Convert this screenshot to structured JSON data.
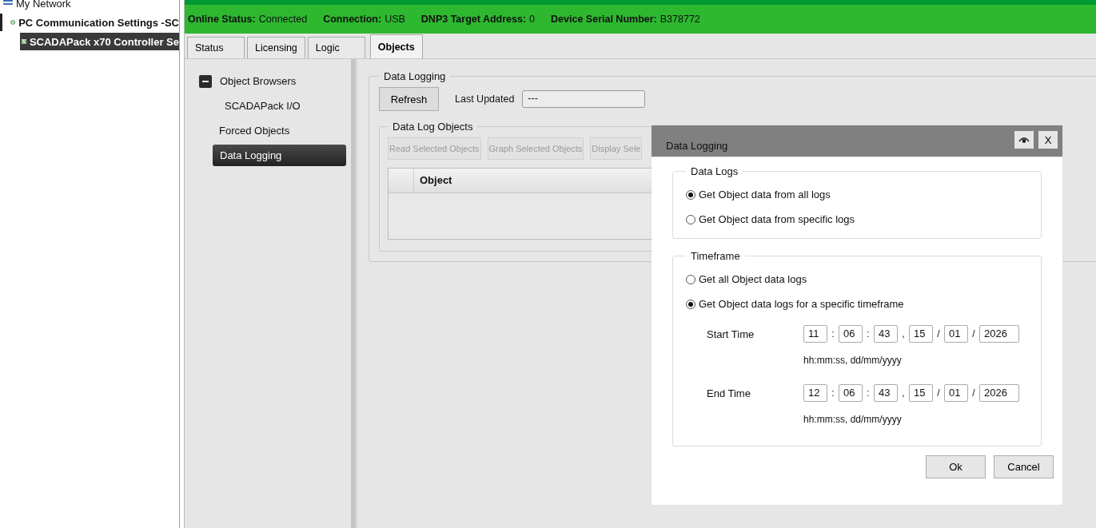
{
  "tree": [
    {
      "label": "My Network",
      "selected": false,
      "children": [
        {
          "label": "PC Communication Settings -SC",
          "selected": false,
          "children": [
            {
              "label": "SCADAPack x70 Controller Se",
              "selected": true
            }
          ]
        }
      ]
    }
  ],
  "status_bar": [
    {
      "label": "Online Status:",
      "value": "Connected"
    },
    {
      "label": "Connection:",
      "value": "USB"
    },
    {
      "label": "DNP3 Target Address:",
      "value": "0"
    },
    {
      "label": "Device Serial Number:",
      "value": "B378772"
    }
  ],
  "tabs": [
    {
      "label": "Status",
      "selected": false
    },
    {
      "label": "Licensing",
      "selected": false
    },
    {
      "label": "Logic",
      "selected": false
    },
    {
      "label": "Objects",
      "selected": true
    }
  ],
  "nav": [
    {
      "label": "Object Browsers",
      "selected": false,
      "expanded": true,
      "children": [
        {
          "label": "SCADAPack I/O",
          "selected": false
        }
      ]
    },
    {
      "label": "Forced Objects",
      "selected": false
    },
    {
      "label": "Data Logging",
      "selected": true
    }
  ],
  "data_logging": {
    "title": "Data Logging",
    "refresh_button": "Refresh",
    "last_updated_label": "Last Updated",
    "last_updated_value": "---",
    "objects_group": {
      "title": "Data Log Objects",
      "buttons": [
        {
          "label": "Read Selected Objects",
          "disabled": true
        },
        {
          "label": "Graph Selected Objects",
          "disabled": true
        },
        {
          "label": "Display Sele",
          "disabled": true
        }
      ],
      "columns": [
        "Object"
      ]
    }
  },
  "dialog": {
    "title": "Data Logging",
    "close_label": "X",
    "data_logs": {
      "title": "Data Logs",
      "options": [
        {
          "label": "Get Object data from all logs",
          "selected": true
        },
        {
          "label": "Get Object data from specific logs",
          "selected": false
        }
      ]
    },
    "timeframe": {
      "title": "Timeframe",
      "options": [
        {
          "label": "Get all Object data logs",
          "selected": false
        },
        {
          "label": "Get Object data logs for a specific timeframe",
          "selected": true
        }
      ],
      "rows": [
        {
          "label": "Start Time",
          "hint": "hh:mm:ss, dd/mm/yyyy",
          "parts": [
            {
              "kind": "field",
              "value": "11"
            },
            {
              "kind": "sep",
              "text": ":"
            },
            {
              "kind": "field",
              "value": "06"
            },
            {
              "kind": "sep",
              "text": ":"
            },
            {
              "kind": "field",
              "value": "43"
            },
            {
              "kind": "sep",
              "text": ","
            },
            {
              "kind": "field",
              "value": "15"
            },
            {
              "kind": "sep",
              "text": "/"
            },
            {
              "kind": "field",
              "value": "01"
            },
            {
              "kind": "sep",
              "text": "/"
            },
            {
              "kind": "field",
              "value": "2026",
              "wide": true
            }
          ]
        },
        {
          "label": "End Time",
          "hint": "hh:mm:ss, dd/mm/yyyy",
          "parts": [
            {
              "kind": "field",
              "value": "12"
            },
            {
              "kind": "sep",
              "text": ":"
            },
            {
              "kind": "field",
              "value": "06"
            },
            {
              "kind": "sep",
              "text": ":"
            },
            {
              "kind": "field",
              "value": "43"
            },
            {
              "kind": "sep",
              "text": ","
            },
            {
              "kind": "field",
              "value": "15"
            },
            {
              "kind": "sep",
              "text": "/"
            },
            {
              "kind": "field",
              "value": "01"
            },
            {
              "kind": "sep",
              "text": "/"
            },
            {
              "kind": "field",
              "value": "2026",
              "wide": true
            }
          ]
        }
      ]
    },
    "buttons": [
      "Ok",
      "Cancel"
    ]
  }
}
